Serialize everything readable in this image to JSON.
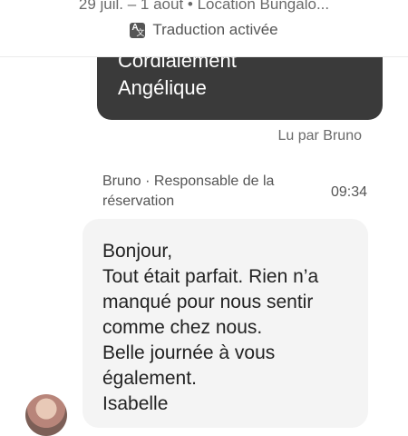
{
  "header": {
    "subtitle": "29 juil. – 1 août • Location Bungalo...",
    "translation_label": "Traduction activée",
    "translation_icon": "translate-icon"
  },
  "own_message": {
    "text": "Cordialement\nAngélique",
    "bubble_color": "#3a3a3a"
  },
  "read_receipt": "Lu par Bruno",
  "received_message": {
    "sender": "Bruno · Responsable de la réservation",
    "time": "09:34",
    "text": "Bonjour,\nTout était parfait. Rien n’a manqué pour nous sentir comme chez nous.\nBelle journée à vous également.\nIsabelle",
    "bubble_color": "#f4f4f4"
  }
}
